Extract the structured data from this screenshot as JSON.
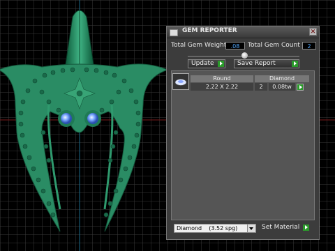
{
  "panel": {
    "title": "GEM REPORTER",
    "total_weight_label": "Total Gem Weight",
    "total_weight_value": ".08",
    "total_count_label": "Total Gem Count",
    "total_count_value": "2",
    "update_label": "Update",
    "save_label": "Save Report",
    "gem": {
      "shape_header": "Round",
      "size": "2.22 X 2.22",
      "material_header": "Diamond",
      "count": "2",
      "weight": "0.08tw"
    },
    "material_select": {
      "name": "Diamond",
      "sg": "(3.52 spg)"
    },
    "set_material_label": "Set Material"
  },
  "colors": {
    "jewel": "#2a8c64",
    "gem": "#6fa8ff",
    "accent_go": "#2a9a2a"
  },
  "icons": [
    "close-icon",
    "gem-thumbnail-icon",
    "go-arrow-icon",
    "dropdown-arrow-icon"
  ]
}
